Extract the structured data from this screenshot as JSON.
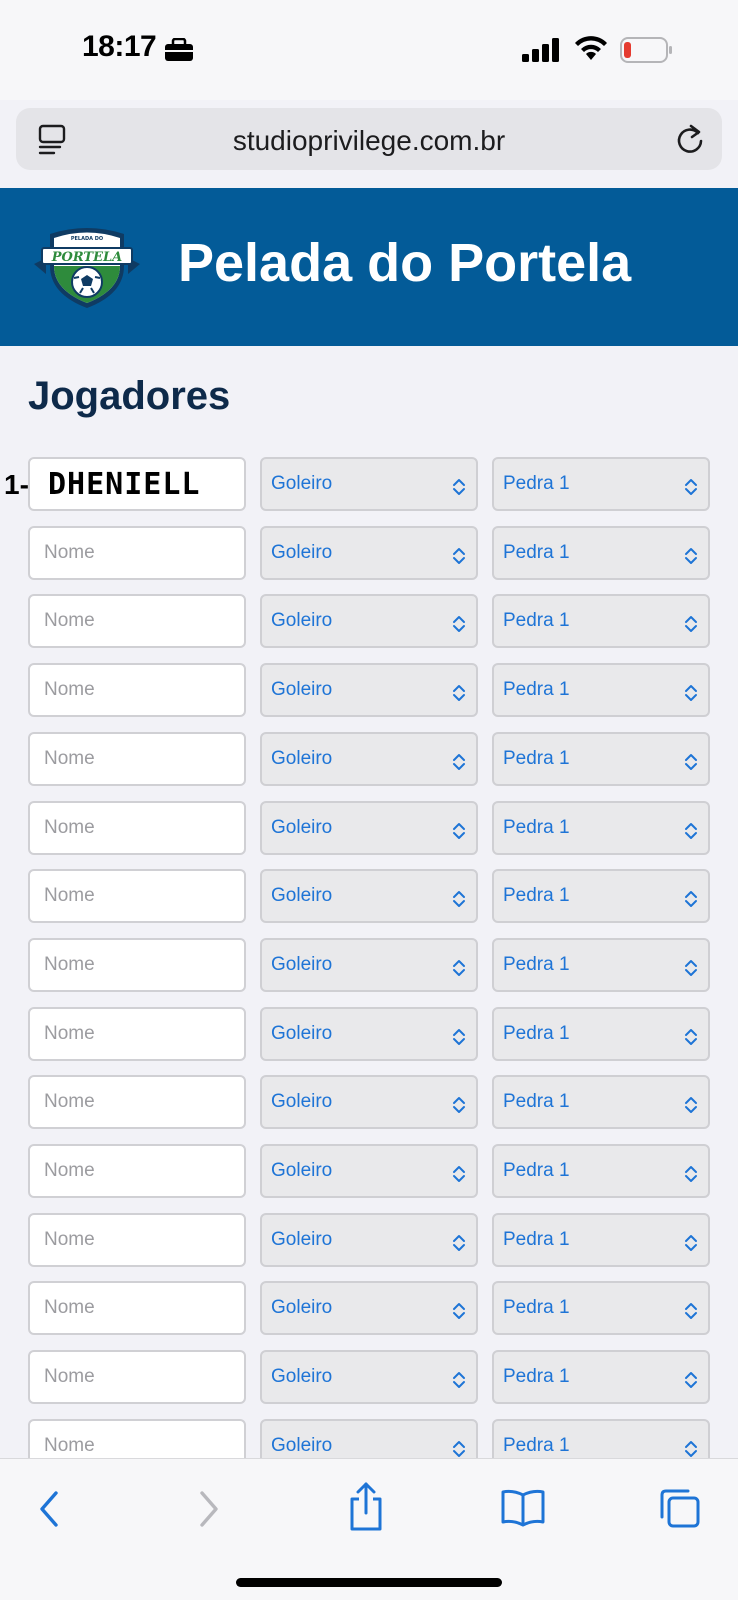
{
  "status_bar": {
    "time": "18:17"
  },
  "browser": {
    "url": "studioprivilege.com.br"
  },
  "header": {
    "logo_top_text": "PELADA DO",
    "logo_main_text": "PORTELA",
    "title": "Pelada do Portela"
  },
  "section_title": "Jogadores",
  "players": [
    {
      "number": "1-",
      "name": "DHENIELL",
      "placeholder": "",
      "position": "Goleiro",
      "team": "Pedra 1"
    },
    {
      "number": "",
      "name": "",
      "placeholder": "Nome",
      "position": "Goleiro",
      "team": "Pedra 1"
    },
    {
      "number": "",
      "name": "",
      "placeholder": "Nome",
      "position": "Goleiro",
      "team": "Pedra 1"
    },
    {
      "number": "",
      "name": "",
      "placeholder": "Nome",
      "position": "Goleiro",
      "team": "Pedra 1"
    },
    {
      "number": "",
      "name": "",
      "placeholder": "Nome",
      "position": "Goleiro",
      "team": "Pedra 1"
    },
    {
      "number": "",
      "name": "",
      "placeholder": "Nome",
      "position": "Goleiro",
      "team": "Pedra 1"
    },
    {
      "number": "",
      "name": "",
      "placeholder": "Nome",
      "position": "Goleiro",
      "team": "Pedra 1"
    },
    {
      "number": "",
      "name": "",
      "placeholder": "Nome",
      "position": "Goleiro",
      "team": "Pedra 1"
    },
    {
      "number": "",
      "name": "",
      "placeholder": "Nome",
      "position": "Goleiro",
      "team": "Pedra 1"
    },
    {
      "number": "",
      "name": "",
      "placeholder": "Nome",
      "position": "Goleiro",
      "team": "Pedra 1"
    },
    {
      "number": "",
      "name": "",
      "placeholder": "Nome",
      "position": "Goleiro",
      "team": "Pedra 1"
    },
    {
      "number": "",
      "name": "",
      "placeholder": "Nome",
      "position": "Goleiro",
      "team": "Pedra 1"
    },
    {
      "number": "",
      "name": "",
      "placeholder": "Nome",
      "position": "Goleiro",
      "team": "Pedra 1"
    },
    {
      "number": "",
      "name": "",
      "placeholder": "Nome",
      "position": "Goleiro",
      "team": "Pedra 1"
    },
    {
      "number": "",
      "name": "",
      "placeholder": "Nome",
      "position": "Goleiro",
      "team": "Pedra 1"
    }
  ],
  "icons": {
    "status": [
      "briefcase-icon",
      "cellular-signal-icon",
      "wifi-icon",
      "battery-low-icon"
    ],
    "browser": [
      "reader-mode-icon",
      "reload-icon"
    ],
    "toolbar": [
      "back-icon",
      "forward-icon",
      "share-icon",
      "bookmarks-icon",
      "tabs-icon"
    ]
  },
  "colors": {
    "header_bg": "#035b98",
    "select_text": "#1e74d6",
    "toolbar_icon": "#1e74d6",
    "battery_low": "#e53b30"
  }
}
